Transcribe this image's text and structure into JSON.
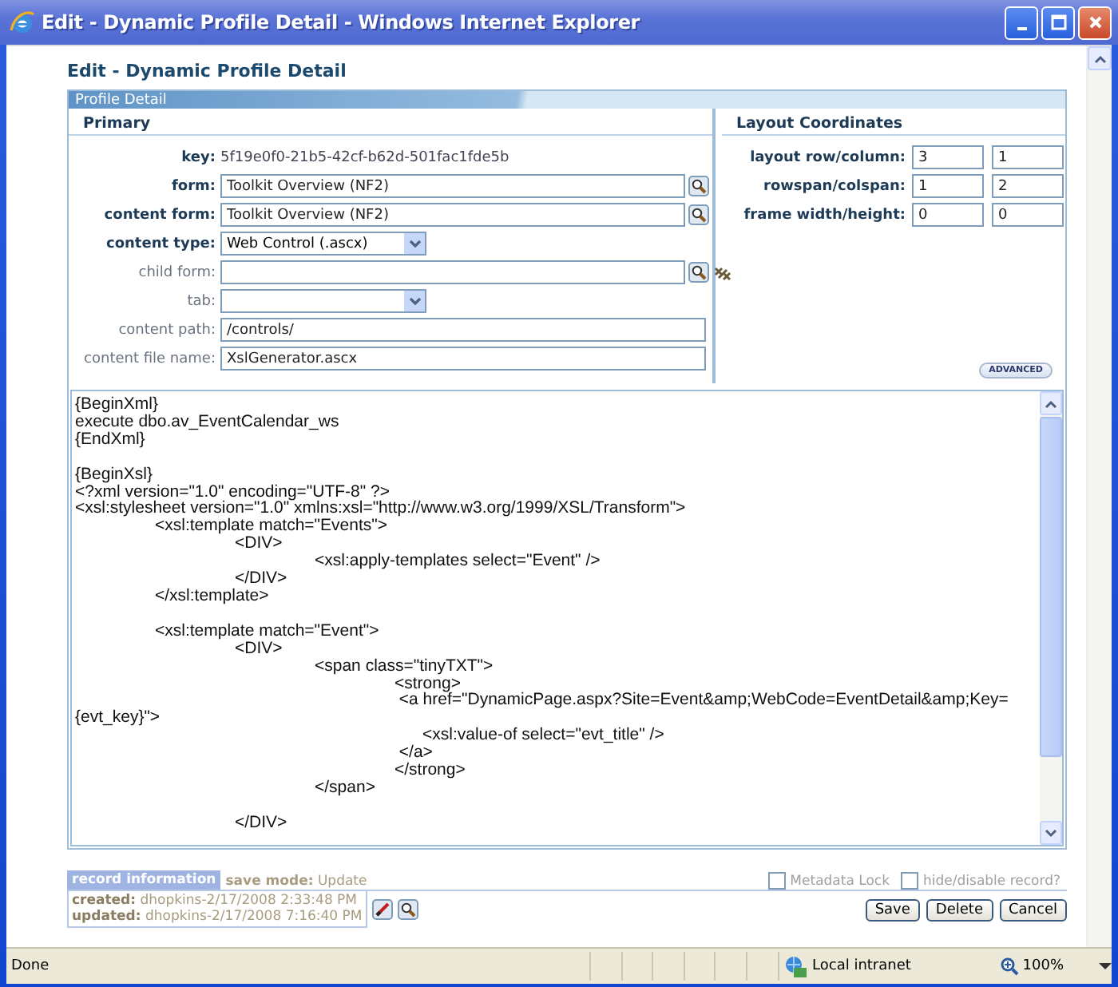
{
  "window": {
    "title": "Edit - Dynamic Profile Detail - Windows Internet Explorer"
  },
  "page_title": "Edit - Dynamic Profile Detail",
  "panel": {
    "title": "Profile Detail"
  },
  "primary": {
    "title": "Primary",
    "fields": [
      {
        "kind": "static",
        "label": "key:",
        "value": "5f19e0f0-21b5-42cf-b62d-501fac1fde5b",
        "required": true
      },
      {
        "kind": "lookup",
        "label": "form:",
        "value": "Toolkit Overview (NF2)",
        "required": true
      },
      {
        "kind": "lookup",
        "label": "content form:",
        "value": "Toolkit Overview (NF2)",
        "required": true
      },
      {
        "kind": "select",
        "label": "content type:",
        "value": "Web Control (.ascx)",
        "required": true
      },
      {
        "kind": "lookup_link",
        "label": "child form:",
        "required": false
      },
      {
        "kind": "select",
        "label": "tab:",
        "required": false
      },
      {
        "kind": "text",
        "label": "content path:",
        "value": "/controls/",
        "required": false
      },
      {
        "kind": "text",
        "label": "content file name:",
        "value": "XslGenerator.ascx",
        "required": false
      }
    ]
  },
  "layout": {
    "title": "Layout Coordinates",
    "fields": [
      {
        "label": "layout row/column:",
        "values": [
          "3",
          "1"
        ]
      },
      {
        "label": "rowspan/colspan:",
        "values": [
          "1",
          "2"
        ]
      },
      {
        "label": "frame width/height:",
        "values": [
          "0",
          "0"
        ]
      }
    ],
    "advanced_button": "ADVANCED"
  },
  "code": "{BeginXml}\nexecute dbo.av_EventCalendar_ws\n{EndXml}\n\n{BeginXsl}\n<?xml version=\"1.0\" encoding=\"UTF-8\" ?>\n<xsl:stylesheet version=\"1.0\" xmlns:xsl=\"http://www.w3.org/1999/XSL/Transform\">\n\t<xsl:template match=\"Events\">\n\t\t<DIV>\n\t\t\t<xsl:apply-templates select=\"Event\" />\n\t\t</DIV>\n\t</xsl:template>\n\n\t<xsl:template match=\"Event\">\n\t\t<DIV>\n\t\t\t<span class=\"tinyTXT\">\n\t\t\t\t<strong>\n\t\t\t\t <a href=\"DynamicPage.aspx?Site=Event&amp;WebCode=EventDetail&amp;Key=\n{evt_key}\">\n\t\t\t\t      <xsl:value-of select=\"evt_title\" />\n\t\t\t\t </a>\n\t\t\t\t</strong>\n\t\t\t</span>\n\n\t\t</DIV>",
  "footer": {
    "record_tab": "record information",
    "save_mode": {
      "label": "save mode:",
      "value": "Update"
    },
    "checks": [
      {
        "label": "Metadata Lock",
        "checked": false
      },
      {
        "label": "hide/disable record?",
        "checked": false
      }
    ],
    "record": [
      {
        "label": "created:",
        "value": "dhopkins-2/17/2008 2:33:48 PM"
      },
      {
        "label": "updated:",
        "value": "dhopkins-2/17/2008 7:16:40 PM"
      }
    ],
    "buttons": [
      "Save",
      "Delete",
      "Cancel"
    ]
  },
  "status_bar": {
    "text": "Done",
    "zone": "Local intranet",
    "zoom": "100%"
  }
}
